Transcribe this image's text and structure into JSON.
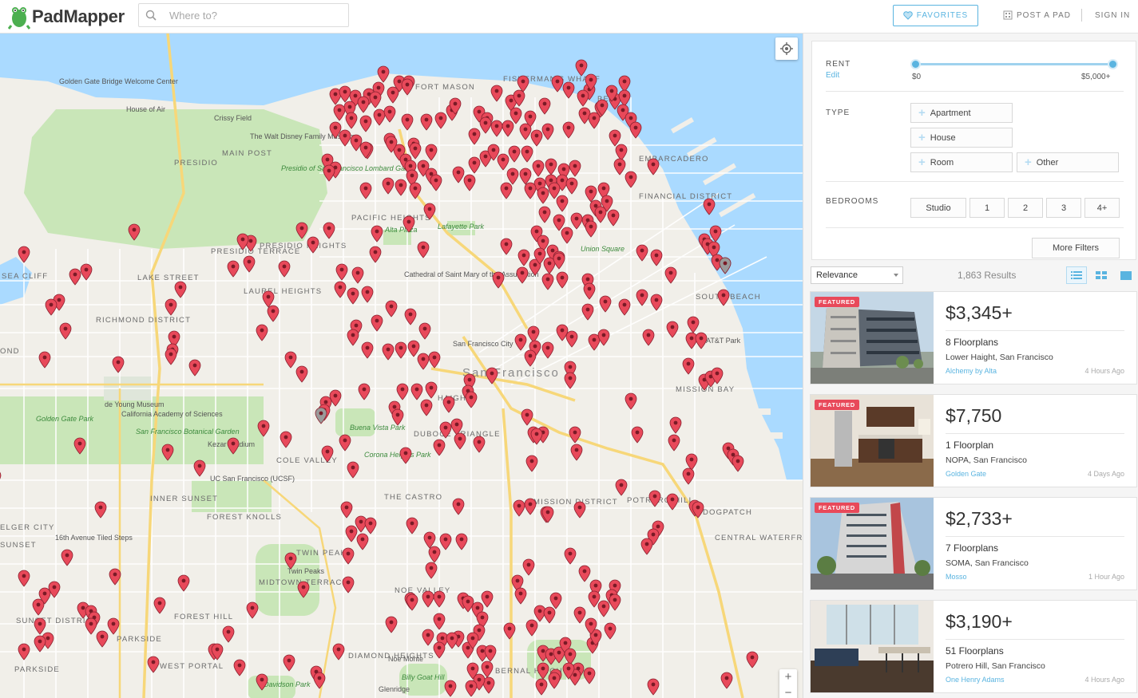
{
  "header": {
    "logo_text": "PadMapper",
    "search_placeholder": "Where to?",
    "favorites_label": "FAVORITES",
    "post_label": "POST A PAD",
    "signin_label": "SIGN IN"
  },
  "map": {
    "labels": {
      "ggb": "Golden Gate Bridge Welcome Center",
      "house_of_air": "House of Air",
      "crissy": "Crissy Field",
      "disney": "The Walt Disney Family Museum",
      "main_post": "MAIN POST",
      "presidio": "PRESIDIO",
      "presidio_sf": "Presidio of San Francisco Lombard Gate",
      "fort_mason": "FORT MASON",
      "fishermans": "FISHERMAN'S WHARF",
      "beach": "BEACH",
      "embarcadero": "EMBARCADERO",
      "financial": "FINANCIAL DISTRICT",
      "pacific_heights": "PACIFIC HEIGHTS",
      "alta_plaza": "Alta Plaza",
      "lafayette": "Lafayette Park",
      "union_square": "Union Square",
      "presidio_heights": "PRESIDIO HEIGHTS",
      "presidio_terrace": "PRESIDIO TERRACE",
      "sea_cliff": "SEA CLIFF",
      "lake_street": "LAKE STREET",
      "laurel": "LAUREL HEIGHTS",
      "cathedral": "Cathedral of Saint Mary of the Assumption",
      "richmond": "RICHMOND DISTRICT",
      "sf_city": "San Francisco City",
      "sf_big": "San Francisco",
      "south_beach": "SOUTH BEACH",
      "at_park": "AT&T Park",
      "mission_bay": "MISSION BAY",
      "de_young": "de Young Museum",
      "cal_academy": "California Academy of Sciences",
      "botanical": "San Francisco Botanical Garden",
      "gg_park": "Golden Gate Park",
      "haight": "HAIGHT",
      "buena_vista": "Buena Vista Park",
      "duboce": "DUBOCE TRIANGLE",
      "kezar": "Kezar Stadium",
      "cole_valley": "COLE VALLEY",
      "corona": "Corona Heights Park",
      "ucsf": "UC San Francisco (UCSF)",
      "inner_sunset": "INNER SUNSET",
      "the_castro": "THE CASTRO",
      "mission": "MISSION DISTRICT",
      "potrero": "POTRERO HILL",
      "dogpatch": "DOGPATCH",
      "central_waterfront": "CENTRAL WATERFRONT",
      "forest_knolls": "FOREST KNOLLS",
      "outer_sunset_city": "ELGER CITY",
      "sunset": "SUNSET",
      "tiled_steps": "16th Avenue Tiled Steps",
      "twin_peaks": "TWIN PEAKS",
      "twin_peaks2": "Twin Peaks",
      "midtown": "MIDTOWN TERRACE",
      "noe": "NOE VALLEY",
      "forest_hill": "FOREST HILL",
      "sunset_district": "SUNSET DISTRICT",
      "parkside": "PARKSIDE",
      "parkside2": "PARKSIDE",
      "west_portal": "WEST PORTAL",
      "diamond": "DIAMOND HEIGHTS",
      "noe_monte": "Noe Monte",
      "billy_goat": "Billy Goat Hill",
      "bernal": "BERNAL HEIGHTS",
      "davidson": "Davidson Park",
      "glenridge": "Glenridge",
      "inner_richmond": "OND"
    },
    "zoom_in": "+",
    "zoom_out": "−"
  },
  "filters": {
    "rent_label": "RENT",
    "rent_edit": "Edit",
    "rent_min": "$0",
    "rent_max": "$5,000+",
    "type_label": "TYPE",
    "types": [
      "Apartment",
      "House",
      "Room",
      "Other"
    ],
    "bedrooms_label": "BEDROOMS",
    "bedrooms": [
      "Studio",
      "1",
      "2",
      "3",
      "4+"
    ],
    "more_filters": "More Filters"
  },
  "results": {
    "sort_value": "Relevance",
    "count": "1,863 Results"
  },
  "listings": [
    {
      "badge": "FEATURED",
      "price": "$3,345+",
      "floorplans": "8 Floorplans",
      "location": "Lower Haight, San Francisco",
      "agent": "Alchemy by Alta",
      "age": "4 Hours Ago"
    },
    {
      "badge": "FEATURED",
      "price": "$7,750",
      "floorplans": "1 Floorplan",
      "location": "NOPA, San Francisco",
      "agent": "Golden Gate",
      "age": "4 Days Ago"
    },
    {
      "badge": "FEATURED",
      "price": "$2,733+",
      "floorplans": "7 Floorplans",
      "location": "SOMA, San Francisco",
      "agent": "Mosso",
      "age": "1 Hour Ago"
    },
    {
      "badge": "",
      "price": "$3,190+",
      "floorplans": "51 Floorplans",
      "location": "Potrero Hill, San Francisco",
      "agent": "One Henry Adams",
      "age": "4 Hours Ago"
    }
  ],
  "colors": {
    "accent": "#5ab4e0",
    "pin": "#e8495a",
    "featured": "#e8495a",
    "water": "#aadaff",
    "park": "#c9e6b8"
  }
}
